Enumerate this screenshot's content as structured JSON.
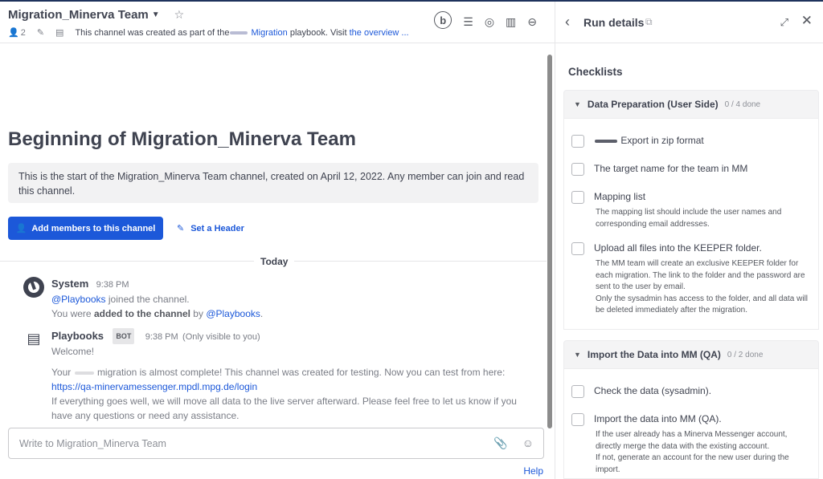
{
  "channel": {
    "name": "Migration_Minerva Team",
    "member_count": "2",
    "purpose_prefix": "This channel was created as part of the",
    "purpose_link_playbook": "Migration",
    "purpose_middle": "playbook. Visit",
    "purpose_link_overview": "the overview ...",
    "header_icons": [
      "b-badge-icon",
      "list-icon",
      "target-icon",
      "clipboard-icon",
      "minus-circle-icon"
    ]
  },
  "intro": {
    "title": "Beginning of Migration_Minerva Team",
    "text": "This is the start of the Migration_Minerva Team channel, created on April 12, 2022. Any member can join and read this channel.",
    "add_members_label": "Add members to this channel",
    "set_header_label": "Set a Header"
  },
  "date_separator": "Today",
  "posts": [
    {
      "author": "System",
      "time": "9:38 PM",
      "line1_mention": "@Playbooks",
      "line1_rest": "joined the channel.",
      "line2_prefix": "You were",
      "line2_bold": "added to the channel",
      "line2_by": "by",
      "line2_mention": "@Playbooks",
      "line2_end": "."
    },
    {
      "author": "Playbooks",
      "badge": "BOT",
      "time": "9:38 PM",
      "visibility": "(Only visible to you)",
      "welcome": "Welcome!",
      "msg1_prefix": "Your",
      "msg1_rest": "migration is almost complete! This channel was created for testing. Now you can test from here:",
      "link": "https://qa-minervamessenger.mpdl.mpg.de/login",
      "msg2": "If everything goes well, we will move all data to the live server afterward. Please feel free to let us know if you have any questions or need any assistance."
    }
  ],
  "composer": {
    "placeholder": "Write to Migration_Minerva Team"
  },
  "help_label": "Help",
  "rhs": {
    "title": "Run details",
    "section_title": "Checklists",
    "checklists": [
      {
        "title": "Data Preparation (User Side)",
        "count": "0 / 4 done",
        "items": [
          {
            "label": "Export in zip format",
            "desc": ""
          },
          {
            "label": "The target name for the team in MM",
            "desc": ""
          },
          {
            "label": "Mapping list",
            "desc": "The mapping list should include the user names and corresponding email addresses."
          },
          {
            "label": "Upload all files into the KEEPER folder.",
            "desc": "The MM team will create an exclusive KEEPER folder for each migration. The link to the folder and the password are sent to the user by email.\nOnly the sysadmin has access to the folder, and all data will be deleted immediately after the migration."
          }
        ]
      },
      {
        "title": "Import the Data into MM (QA)",
        "count": "0 / 2 done",
        "items": [
          {
            "label": "Check the data (sysadmin).",
            "desc": ""
          },
          {
            "label": "Import the data into MM (QA).",
            "desc": "If the user already has a Minerva Messenger account, directly merge the data with the existing account.\nIf not, generate an account for the new user during the import."
          }
        ]
      }
    ]
  }
}
